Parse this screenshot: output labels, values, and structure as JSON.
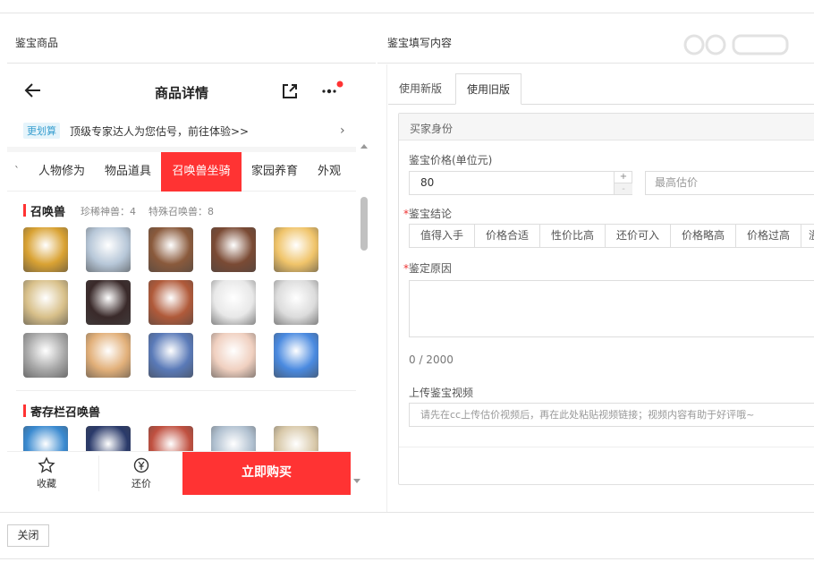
{
  "left_title": "鉴宝商品",
  "right_title": "鉴宝填写内容",
  "phone": {
    "title": "商品详情",
    "banner_tag": "更划算",
    "banner_text": "顶级专家达人为您估号，前往体验>>",
    "tabs": [
      "人物修为",
      "物品道具",
      "召唤兽坐骑",
      "家园养育",
      "外观"
    ],
    "active_tab": 2,
    "pets_title": "召唤兽",
    "rare_count": "珍稀神兽：4",
    "special_count": "特殊召唤兽：8",
    "stash_title": "寄存栏召唤兽",
    "fav_label": "收藏",
    "bargain_label": "还价",
    "buy_label": "立即购买",
    "pet_colors": [
      "#d9a233",
      "#b7c7d8",
      "#8a5a3c",
      "#7a4a34",
      "#f0c46a",
      "#d8c08a",
      "#3a2a2a",
      "#b05a3a",
      "#e8e8e8",
      "#dcdcdc",
      "#a8a8a8",
      "#e2b07a",
      "#5a7ab8",
      "#f0d0c0",
      "#4a8ae0"
    ],
    "stash_colors": [
      "#3a8ad0",
      "#2a3a6a",
      "#c05040",
      "#b0c0d0",
      "#d8c8a8"
    ]
  },
  "form": {
    "tab_new": "使用新版",
    "tab_old": "使用旧版",
    "section_head": "买家身份",
    "price_label": "鉴宝价格(单位元)",
    "price_value": "80",
    "stepper_plus": "+",
    "stepper_minus": "-",
    "max_placeholder": "最高估价",
    "conclusion_label": "鉴宝结论",
    "conclusions": [
      "值得入手",
      "价格合适",
      "性价比高",
      "还价可入",
      "价格略高",
      "价格过高",
      "溢"
    ],
    "reason_label": "鉴定原因",
    "count": "0 / 2000",
    "video_label": "上传鉴宝视频",
    "video_placeholder": "请先在cc上传估价视频后，再在此处粘贴视频链接；视频内容有助于好评哦~",
    "required_mark": "*"
  },
  "close_label": "关闭"
}
